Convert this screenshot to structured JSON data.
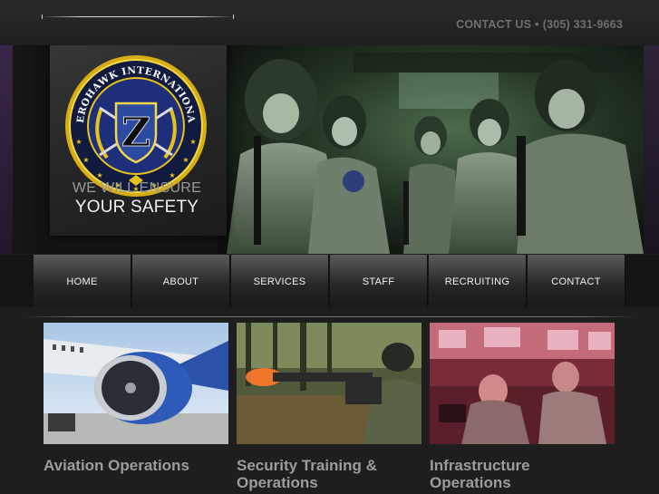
{
  "header": {
    "contact_label": "CONTACT US",
    "separator": "•",
    "phone": "(305) 331-9663"
  },
  "logo": {
    "org_name": "ZEROHAWK INTERNATIONAL",
    "monogram": "Z"
  },
  "hero": {
    "tagline_line1": "WE WILL ENSURE",
    "tagline_line2": "YOUR SAFETY"
  },
  "nav": {
    "items": [
      {
        "label": "HOME"
      },
      {
        "label": "ABOUT"
      },
      {
        "label": "SERVICES"
      },
      {
        "label": "STAFF"
      },
      {
        "label": "RECRUITING"
      },
      {
        "label": "CONTACT"
      }
    ]
  },
  "features": [
    {
      "title_line1": "Aviation Operations",
      "title_line2": ""
    },
    {
      "title_line1": "Security Training &",
      "title_line2": "Operations"
    },
    {
      "title_line1": "Infrastructure",
      "title_line2": "Operations"
    }
  ],
  "colors": {
    "seal_gold": "#e7c21b",
    "seal_blue": "#1d2f7a",
    "nav_text": "#f0f0f0",
    "feature_title": "#9c9c9c",
    "contact_text": "#6f6f6f"
  }
}
